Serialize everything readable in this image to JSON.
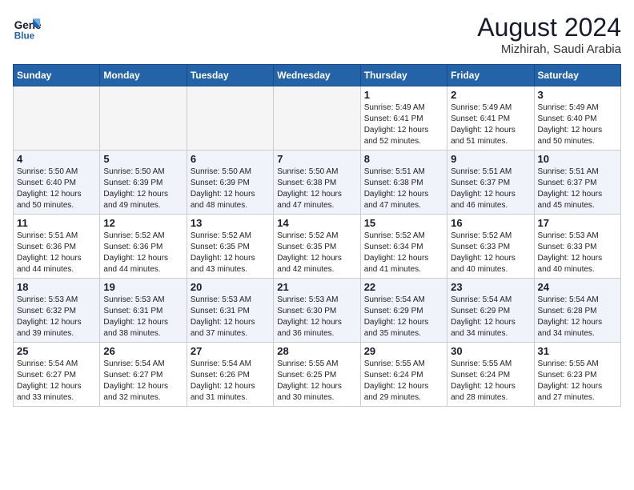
{
  "header": {
    "logo_line1": "General",
    "logo_line2": "Blue",
    "month_year": "August 2024",
    "location": "Mizhirah, Saudi Arabia"
  },
  "days_of_week": [
    "Sunday",
    "Monday",
    "Tuesday",
    "Wednesday",
    "Thursday",
    "Friday",
    "Saturday"
  ],
  "weeks": [
    {
      "row_class": "row-odd",
      "days": [
        {
          "num": "",
          "empty": true
        },
        {
          "num": "",
          "empty": true
        },
        {
          "num": "",
          "empty": true
        },
        {
          "num": "",
          "empty": true
        },
        {
          "num": "1",
          "sunrise": "5:49 AM",
          "sunset": "6:41 PM",
          "daylight": "12 hours and 52 minutes."
        },
        {
          "num": "2",
          "sunrise": "5:49 AM",
          "sunset": "6:41 PM",
          "daylight": "12 hours and 51 minutes."
        },
        {
          "num": "3",
          "sunrise": "5:49 AM",
          "sunset": "6:40 PM",
          "daylight": "12 hours and 50 minutes."
        }
      ]
    },
    {
      "row_class": "row-even",
      "days": [
        {
          "num": "4",
          "sunrise": "5:50 AM",
          "sunset": "6:40 PM",
          "daylight": "12 hours and 50 minutes."
        },
        {
          "num": "5",
          "sunrise": "5:50 AM",
          "sunset": "6:39 PM",
          "daylight": "12 hours and 49 minutes."
        },
        {
          "num": "6",
          "sunrise": "5:50 AM",
          "sunset": "6:39 PM",
          "daylight": "12 hours and 48 minutes."
        },
        {
          "num": "7",
          "sunrise": "5:50 AM",
          "sunset": "6:38 PM",
          "daylight": "12 hours and 47 minutes."
        },
        {
          "num": "8",
          "sunrise": "5:51 AM",
          "sunset": "6:38 PM",
          "daylight": "12 hours and 47 minutes."
        },
        {
          "num": "9",
          "sunrise": "5:51 AM",
          "sunset": "6:37 PM",
          "daylight": "12 hours and 46 minutes."
        },
        {
          "num": "10",
          "sunrise": "5:51 AM",
          "sunset": "6:37 PM",
          "daylight": "12 hours and 45 minutes."
        }
      ]
    },
    {
      "row_class": "row-odd",
      "days": [
        {
          "num": "11",
          "sunrise": "5:51 AM",
          "sunset": "6:36 PM",
          "daylight": "12 hours and 44 minutes."
        },
        {
          "num": "12",
          "sunrise": "5:52 AM",
          "sunset": "6:36 PM",
          "daylight": "12 hours and 44 minutes."
        },
        {
          "num": "13",
          "sunrise": "5:52 AM",
          "sunset": "6:35 PM",
          "daylight": "12 hours and 43 minutes."
        },
        {
          "num": "14",
          "sunrise": "5:52 AM",
          "sunset": "6:35 PM",
          "daylight": "12 hours and 42 minutes."
        },
        {
          "num": "15",
          "sunrise": "5:52 AM",
          "sunset": "6:34 PM",
          "daylight": "12 hours and 41 minutes."
        },
        {
          "num": "16",
          "sunrise": "5:52 AM",
          "sunset": "6:33 PM",
          "daylight": "12 hours and 40 minutes."
        },
        {
          "num": "17",
          "sunrise": "5:53 AM",
          "sunset": "6:33 PM",
          "daylight": "12 hours and 40 minutes."
        }
      ]
    },
    {
      "row_class": "row-even",
      "days": [
        {
          "num": "18",
          "sunrise": "5:53 AM",
          "sunset": "6:32 PM",
          "daylight": "12 hours and 39 minutes."
        },
        {
          "num": "19",
          "sunrise": "5:53 AM",
          "sunset": "6:31 PM",
          "daylight": "12 hours and 38 minutes."
        },
        {
          "num": "20",
          "sunrise": "5:53 AM",
          "sunset": "6:31 PM",
          "daylight": "12 hours and 37 minutes."
        },
        {
          "num": "21",
          "sunrise": "5:53 AM",
          "sunset": "6:30 PM",
          "daylight": "12 hours and 36 minutes."
        },
        {
          "num": "22",
          "sunrise": "5:54 AM",
          "sunset": "6:29 PM",
          "daylight": "12 hours and 35 minutes."
        },
        {
          "num": "23",
          "sunrise": "5:54 AM",
          "sunset": "6:29 PM",
          "daylight": "12 hours and 34 minutes."
        },
        {
          "num": "24",
          "sunrise": "5:54 AM",
          "sunset": "6:28 PM",
          "daylight": "12 hours and 34 minutes."
        }
      ]
    },
    {
      "row_class": "row-odd",
      "days": [
        {
          "num": "25",
          "sunrise": "5:54 AM",
          "sunset": "6:27 PM",
          "daylight": "12 hours and 33 minutes."
        },
        {
          "num": "26",
          "sunrise": "5:54 AM",
          "sunset": "6:27 PM",
          "daylight": "12 hours and 32 minutes."
        },
        {
          "num": "27",
          "sunrise": "5:54 AM",
          "sunset": "6:26 PM",
          "daylight": "12 hours and 31 minutes."
        },
        {
          "num": "28",
          "sunrise": "5:55 AM",
          "sunset": "6:25 PM",
          "daylight": "12 hours and 30 minutes."
        },
        {
          "num": "29",
          "sunrise": "5:55 AM",
          "sunset": "6:24 PM",
          "daylight": "12 hours and 29 minutes."
        },
        {
          "num": "30",
          "sunrise": "5:55 AM",
          "sunset": "6:24 PM",
          "daylight": "12 hours and 28 minutes."
        },
        {
          "num": "31",
          "sunrise": "5:55 AM",
          "sunset": "6:23 PM",
          "daylight": "12 hours and 27 minutes."
        }
      ]
    }
  ]
}
